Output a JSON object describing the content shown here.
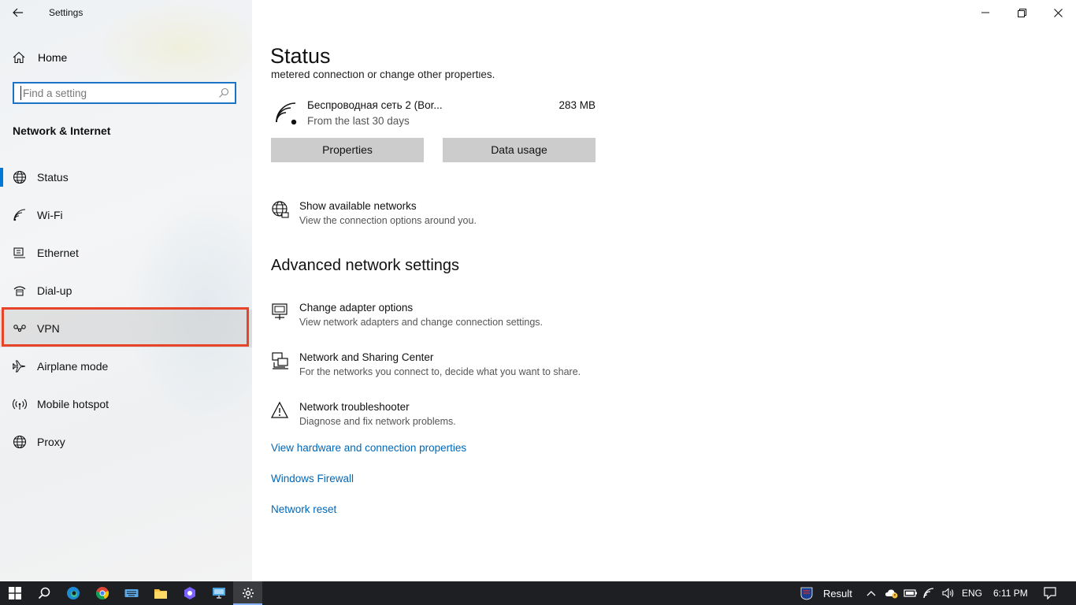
{
  "window": {
    "title": "Settings",
    "back_icon": "back-arrow-icon",
    "controls": [
      "minimize-icon",
      "restore-icon",
      "close-icon"
    ]
  },
  "sidebar": {
    "home_label": "Home",
    "search_placeholder": "Find a setting",
    "section_title": "Network & Internet",
    "items": [
      {
        "label": "Status",
        "icon": "globe-status-icon",
        "active": true
      },
      {
        "label": "Wi-Fi",
        "icon": "wifi-icon"
      },
      {
        "label": "Ethernet",
        "icon": "ethernet-icon"
      },
      {
        "label": "Dial-up",
        "icon": "dialup-icon"
      },
      {
        "label": "VPN",
        "icon": "vpn-icon",
        "highlighted": true
      },
      {
        "label": "Airplane mode",
        "icon": "airplane-icon"
      },
      {
        "label": "Mobile hotspot",
        "icon": "hotspot-icon"
      },
      {
        "label": "Proxy",
        "icon": "globe-icon"
      }
    ]
  },
  "main": {
    "title": "Status",
    "clipped_text": "metered connection or change other properties.",
    "network": {
      "name": "Беспроводная сеть 2 (Bor...",
      "subtitle": "From the last 30 days",
      "usage": "283 MB"
    },
    "buttons": {
      "properties": "Properties",
      "data_usage": "Data usage"
    },
    "show_networks": {
      "title": "Show available networks",
      "subtitle": "View the connection options around you."
    },
    "advanced_heading": "Advanced network settings",
    "advanced": [
      {
        "title": "Change adapter options",
        "subtitle": "View network adapters and change connection settings."
      },
      {
        "title": "Network and Sharing Center",
        "subtitle": "For the networks you connect to, decide what you want to share."
      },
      {
        "title": "Network troubleshooter",
        "subtitle": "Diagnose and fix network problems."
      }
    ],
    "links": [
      "View hardware and connection properties",
      "Windows Firewall",
      "Network reset"
    ]
  },
  "taskbar": {
    "result_label": "Result",
    "language": "ENG",
    "time": "6:11 PM",
    "accent": "#0078d7",
    "link_color": "#0067b8",
    "highlight_color": "#e8442a"
  }
}
